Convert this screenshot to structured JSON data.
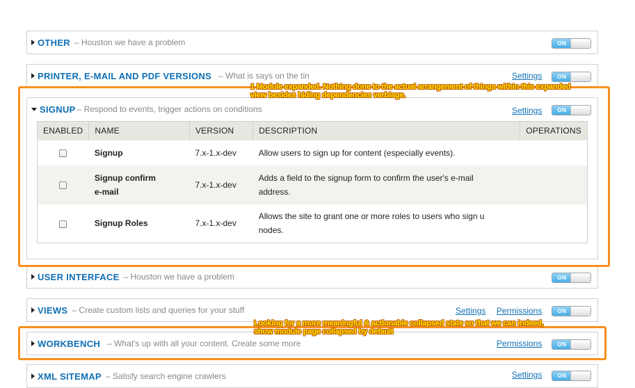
{
  "fieldsets": {
    "other": {
      "title": "OTHER",
      "desc": "– Houston we have a problem"
    },
    "printer": {
      "title": "PRINTER, E-MAIL AND PDF VERSIONS",
      "desc": "– What is says on the tin",
      "settings": "Settings"
    },
    "signup": {
      "title": "SIGNUP",
      "desc": "– Respond to events, trigger actions on conditions",
      "settings": "Settings"
    },
    "user_interface": {
      "title": "USER INTERFACE",
      "desc": "– Houston we have a problem"
    },
    "views": {
      "title": "VIEWS",
      "desc": "– Create custom lists and queries for your stuff",
      "settings": "Settings",
      "permissions": "Permissions"
    },
    "workbench": {
      "title": "WORKBENCH",
      "desc": "– What's up with all your content. Create some more",
      "permissions": "Permissions"
    },
    "xml_sitemap": {
      "title": "XML SITEMAP",
      "desc": "– Satisfy search engine crawlers",
      "settings": "Settings"
    }
  },
  "toggle_label": "ON",
  "table": {
    "headers": [
      "ENABLED",
      "NAME",
      "VERSION",
      "DESCRIPTION",
      "OPERATIONS"
    ],
    "rows": [
      {
        "name": "Signup",
        "version": "7.x-1.x-dev",
        "description": "Allow users to sign up for content (especially events)."
      },
      {
        "name_line1": "Signup confirm",
        "name_line2": "e-mail",
        "version": "7.x-1.x-dev",
        "description_line1": "Adds a field to the signup form to confirm the user's e-mail",
        "description_line2": "address."
      },
      {
        "name": "Signup Roles",
        "version": "7.x-1.x-dev",
        "description_line1": "Allows the site to grant one or more roles to users who sign u",
        "description_line2": "nodes."
      }
    ]
  },
  "annotations": {
    "expanded_line1": "1 Module expanded. Nothing done to the actual arrangement of things within this expanded",
    "expanded_line2": "view besides hiding dependencies verbiage.",
    "collapsed_line1": "Looking for a more meaningful & actionable collapsed state so that we can indeed,",
    "collapsed_line2": "show module page collapsed by default"
  },
  "colors": {
    "link": "#0f6fb5",
    "callout": "#f7901e",
    "annotation_text": "#ffe600",
    "toggle_on": "#48aee8"
  }
}
